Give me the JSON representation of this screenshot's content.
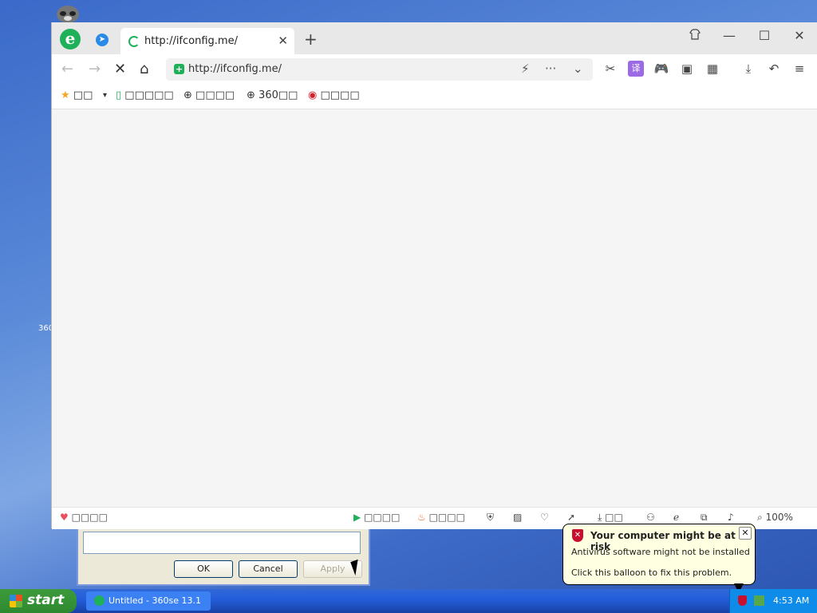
{
  "desktop": {
    "icon_label": "360"
  },
  "browser": {
    "tab": {
      "title": "http://ifconfig.me/",
      "close": "✕"
    },
    "new_tab": "+",
    "window_controls": {
      "skin": "⌂",
      "minimize": "—",
      "maximize": "☐",
      "close": "✕"
    },
    "address": {
      "url": "http://ifconfig.me/"
    },
    "nav": {
      "back": "←",
      "forward": "→",
      "stop": "✕",
      "home": "⌂"
    },
    "address_icons": {
      "flash": "⚡",
      "more": "···",
      "dropdown": "⌄"
    },
    "toolbar": {
      "cut": "✂",
      "translate": "译",
      "game": "🎮",
      "reader": "▣",
      "apps": "▦",
      "download": "⤓",
      "undo": "↶",
      "menu": "≡"
    },
    "favorites": [
      {
        "icon": "★",
        "label": "□□"
      },
      {
        "icon": "▾",
        "label": ""
      },
      {
        "icon": "▯",
        "label": "□□□□□"
      },
      {
        "icon": "⊕",
        "label": "□□□□"
      },
      {
        "icon": "⊕",
        "label": "360□□"
      },
      {
        "icon": "◉",
        "label": "□□□□"
      }
    ],
    "status": {
      "left": "□□□□",
      "video": "□□□□",
      "hot": "□□□□",
      "download": "□□",
      "zoom": "100%"
    }
  },
  "dialog": {
    "ok": "OK",
    "cancel": "Cancel",
    "apply": "Apply"
  },
  "balloon": {
    "title": "Your computer might be at risk",
    "message": "Antivirus software might not be installed",
    "hint": "Click this balloon to fix this problem.",
    "close": "✕"
  },
  "taskbar": {
    "start": "start",
    "task": "Untitled - 360se 13.1",
    "clock": "4:53 AM"
  }
}
